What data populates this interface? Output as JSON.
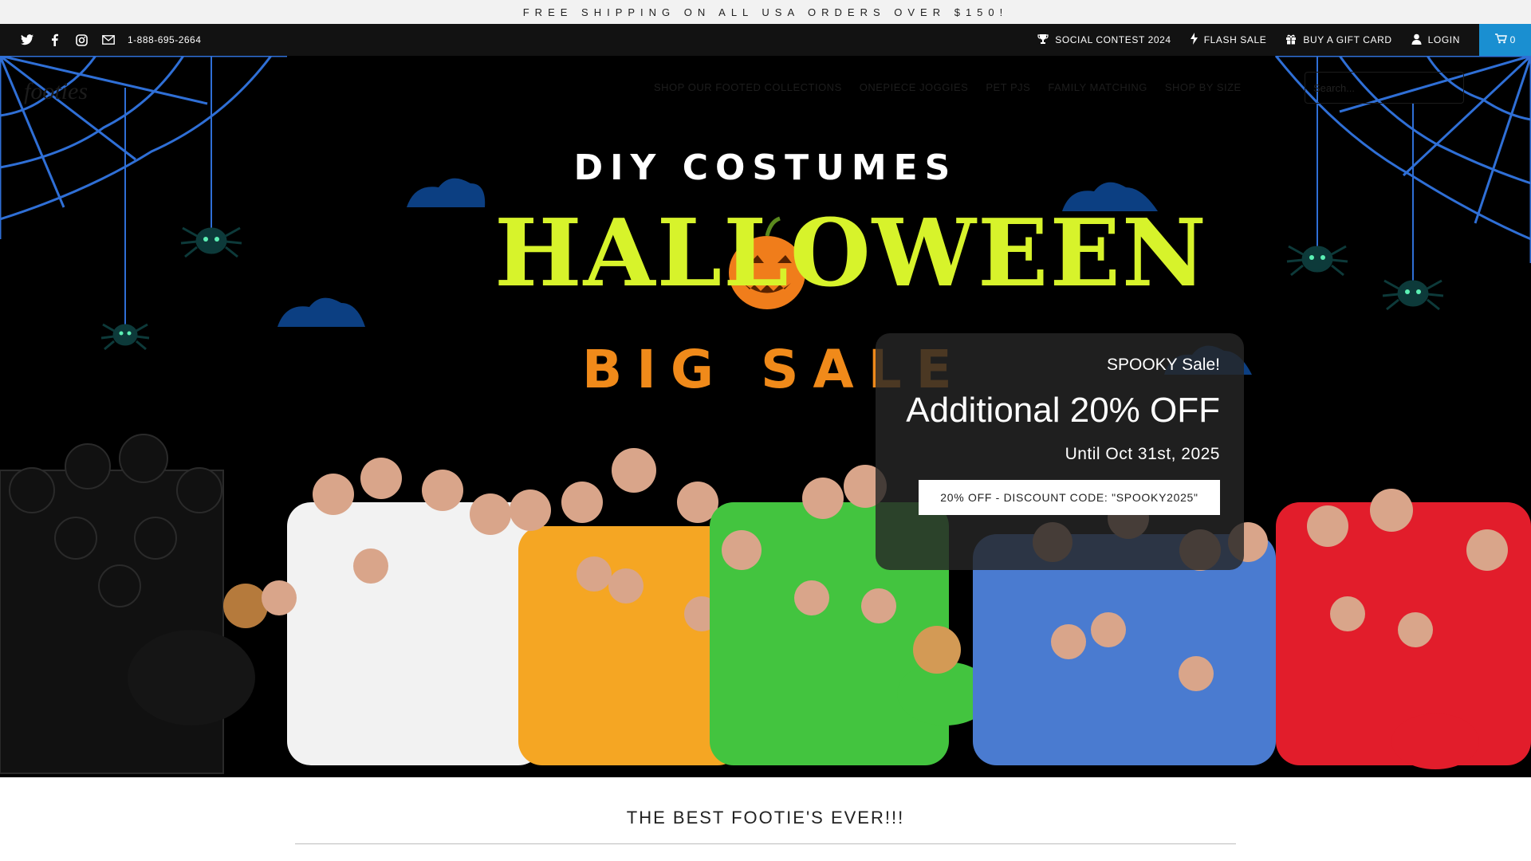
{
  "announcement": {
    "text": "FREE SHIPPING ON ALL USA ORDERS OVER $150!"
  },
  "topbar": {
    "social_icons": [
      "twitter-icon",
      "facebook-icon",
      "instagram-icon",
      "mail-icon"
    ],
    "phone": "1-888-695-2664",
    "links": [
      {
        "label": "SOCIAL CONTEST 2024",
        "icon": "trophy-icon"
      },
      {
        "label": "FLASH SALE",
        "icon": "lightning-icon"
      },
      {
        "label": "BUY A GIFT CARD",
        "icon": "gift-icon"
      },
      {
        "label": "LOGIN",
        "icon": "user-icon"
      }
    ],
    "cart_count": "0",
    "accent_color": "#1a8fd1"
  },
  "header": {
    "nav": [
      "SHOP OUR FOOTED COLLECTIONS",
      "ONEPIECE JOGGIES",
      "PET PJS",
      "FAMILY MATCHING",
      "SHOP BY SIZE"
    ],
    "search_placeholder": "Search..."
  },
  "hero": {
    "line1": "DIY COSTUMES",
    "line2": "HALLOWEEN",
    "line3": "BIG SALE",
    "colors": {
      "halloween": "#d7f32b",
      "big_sale": "#f08a1a",
      "web": "#2f6fd6",
      "cloud": "#0c3f82"
    },
    "pajama_colors": [
      "#111111",
      "#f2f2f2",
      "#f5a623",
      "#43c43f",
      "#4a7bd0",
      "#e21d2b"
    ]
  },
  "promo": {
    "title": "SPOOKY Sale!",
    "headline": "Additional 20% OFF",
    "until": "Until Oct 31st, 2025",
    "button": "20% OFF - DISCOUNT CODE: \"SPOOKY2025\""
  },
  "section": {
    "heading": "THE BEST FOOTIE'S EVER!!!"
  }
}
